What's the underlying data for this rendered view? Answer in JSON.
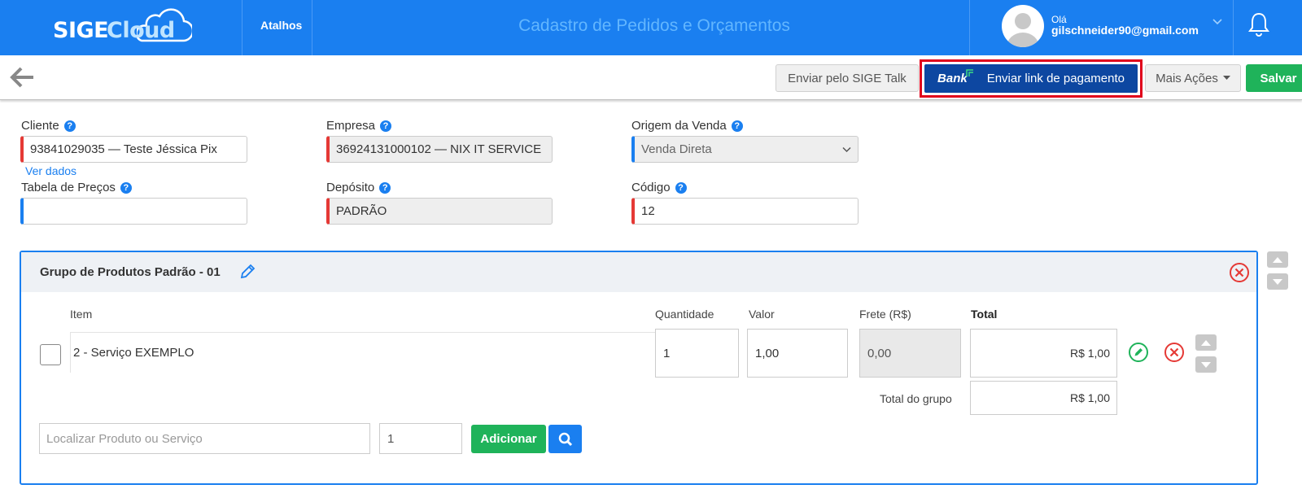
{
  "header": {
    "logo_sige": "SIGE",
    "logo_cloud": "Cloud",
    "shortcuts_label": "Atalhos",
    "page_title": "Cadastro de Pedidos e Orçamentos",
    "greeting": "Olá",
    "user_email": "gilschneider90@gmail.com"
  },
  "toolbar": {
    "talk_label": "Enviar pelo SIGE Talk",
    "bank_label": "Bank",
    "payment_link_label": "Enviar link de pagamento",
    "more_actions_label": "Mais Ações",
    "save_label": "Salvar"
  },
  "form": {
    "cliente_label": "Cliente",
    "cliente_value": "93841029035 — Teste Jéssica Pix",
    "ver_dados": "Ver dados",
    "empresa_label": "Empresa",
    "empresa_value": "36924131000102 — NIX IT SERVICE",
    "origem_label": "Origem da Venda",
    "origem_value": "Venda Direta",
    "tabela_label": "Tabela de Preços",
    "tabela_value": "",
    "deposito_label": "Depósito",
    "deposito_value": "PADRÃO",
    "codigo_label": "Código",
    "codigo_value": "12"
  },
  "group": {
    "title": "Grupo de Produtos Padrão - 01",
    "columns": {
      "item": "Item",
      "quantidade": "Quantidade",
      "valor": "Valor",
      "frete": "Frete (R$)",
      "total": "Total"
    },
    "row": {
      "item": "2 - Serviço EXEMPLO",
      "quantidade": "1",
      "valor": "1,00",
      "frete": "0,00",
      "total": "R$ 1,00"
    },
    "total_grupo_label": "Total do grupo",
    "total_grupo_value": "R$ 1,00",
    "search_placeholder": "Localizar Produto ou Serviço",
    "add_qty": "1",
    "add_label": "Adicionar"
  },
  "colors": {
    "header_blue": "#1a7ff0",
    "bank_button": "#0d47a1",
    "save_green": "#1fb35a",
    "highlight_red": "#e0001b"
  }
}
